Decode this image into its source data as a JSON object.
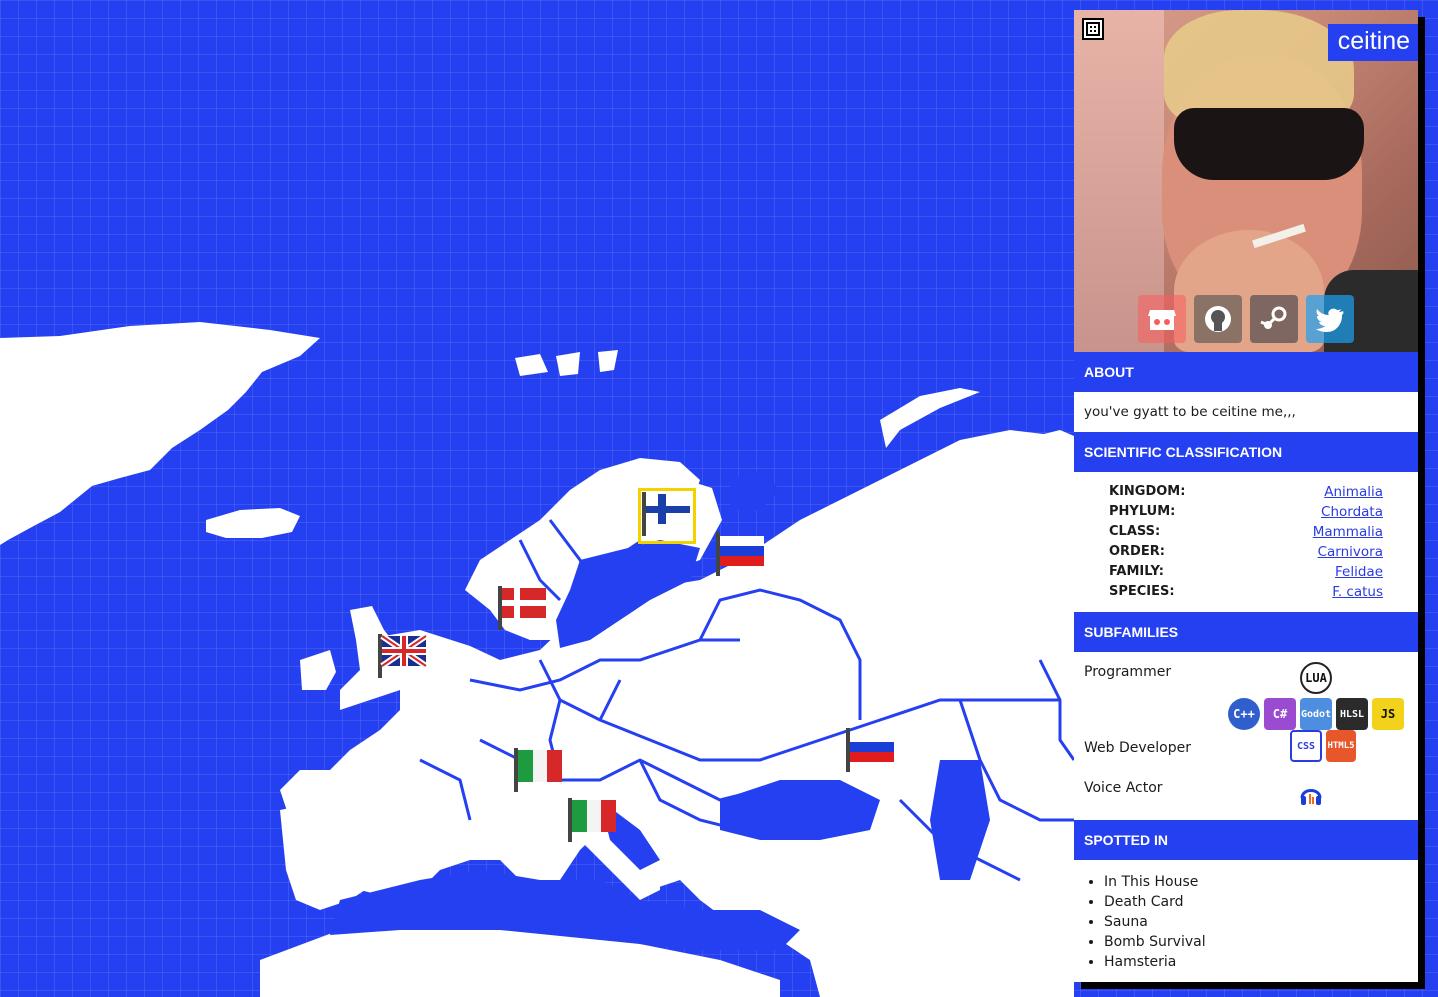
{
  "profile": {
    "name": "ceitine",
    "about_heading": "ABOUT",
    "about_text": "you've gyatt to be ceitine me,,,",
    "classification_heading": "SCIENTIFIC CLASSIFICATION",
    "classification": [
      {
        "label": "KINGDOM:",
        "value": "Animalia"
      },
      {
        "label": "PHYLUM:",
        "value": "Chordata"
      },
      {
        "label": "CLASS:",
        "value": "Mammalia"
      },
      {
        "label": "ORDER:",
        "value": "Carnivora"
      },
      {
        "label": "FAMILY:",
        "value": "Felidae"
      },
      {
        "label": "SPECIES:",
        "value": "F. catus"
      }
    ],
    "subfamilies_heading": "SUBFAMILIES",
    "subfamilies": [
      {
        "label": "Programmer",
        "icons": [
          "LUA",
          "C++",
          "C#",
          "Godot",
          "HLSL",
          "JS"
        ]
      },
      {
        "label": "Web Developer",
        "icons": [
          "CSS",
          "HTML5"
        ]
      },
      {
        "label": "Voice Actor",
        "icons": [
          "audacity-icon"
        ]
      }
    ],
    "spotted_heading": "SPOTTED IN",
    "spotted": [
      "In This House",
      "Death Card",
      "Sauna",
      "Bomb Survival",
      "Hamsteria"
    ],
    "socials": [
      "itch-io-icon",
      "github-icon",
      "steam-icon",
      "twitter-icon"
    ]
  },
  "map": {
    "flags": [
      {
        "country": "Finland",
        "selected": true
      },
      {
        "country": "Russia",
        "selected": false
      },
      {
        "country": "Denmark",
        "selected": false
      },
      {
        "country": "United Kingdom",
        "selected": false
      },
      {
        "country": "Italy",
        "selected": false
      },
      {
        "country": "Italy",
        "selected": false
      },
      {
        "country": "Russia",
        "selected": false
      }
    ]
  },
  "colors": {
    "accent": "#2540f0",
    "land": "#ffffff",
    "link": "#2a3be0",
    "selection": "#f2d200"
  }
}
